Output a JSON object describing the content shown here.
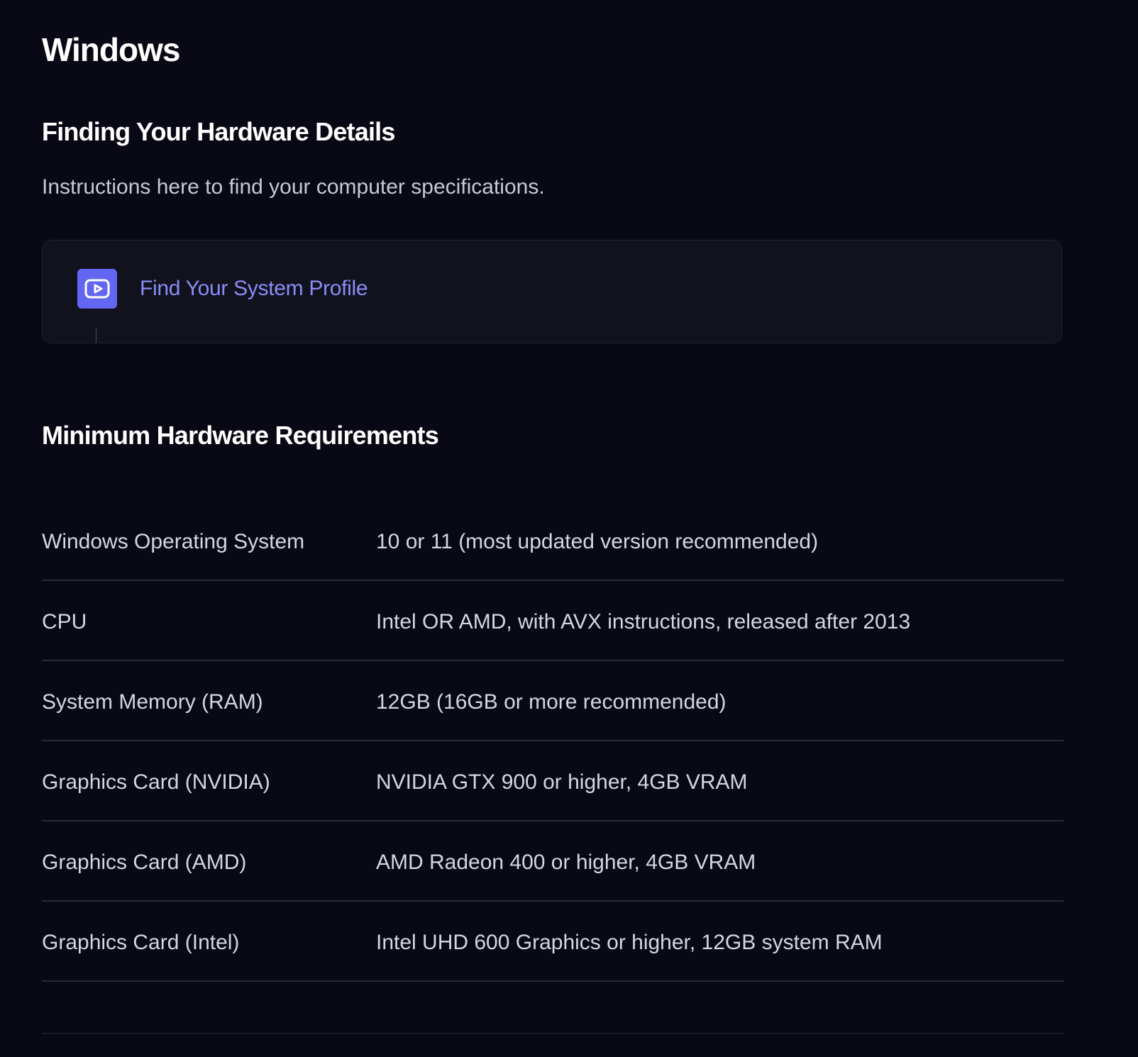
{
  "page": {
    "title": "Windows"
  },
  "hardware_details": {
    "heading": "Finding Your Hardware Details",
    "intro": "Instructions here to find your computer specifications.",
    "profile_link_label": "Find Your System Profile",
    "profile_icon": "video-play-icon"
  },
  "minimum_requirements": {
    "heading": "Minimum Hardware Requirements",
    "rows": [
      {
        "label": "Windows Operating System",
        "value": "10 or 11 (most updated version recommended)"
      },
      {
        "label": "CPU",
        "value": "Intel OR AMD, with AVX instructions, released after 2013"
      },
      {
        "label": "System Memory (RAM)",
        "value": "12GB (16GB or more recommended)"
      },
      {
        "label": "Graphics Card (NVIDIA)",
        "value": "NVIDIA GTX 900 or higher, 4GB VRAM"
      },
      {
        "label": "Graphics Card (AMD)",
        "value": "AMD Radeon 400 or higher, 4GB VRAM"
      },
      {
        "label": "Graphics Card (Intel)",
        "value": "Intel UHD 600 Graphics or higher, 12GB system RAM"
      }
    ]
  },
  "colors": {
    "background": "#090915",
    "accent": "#6366f1",
    "link": "#8b8cf6"
  }
}
